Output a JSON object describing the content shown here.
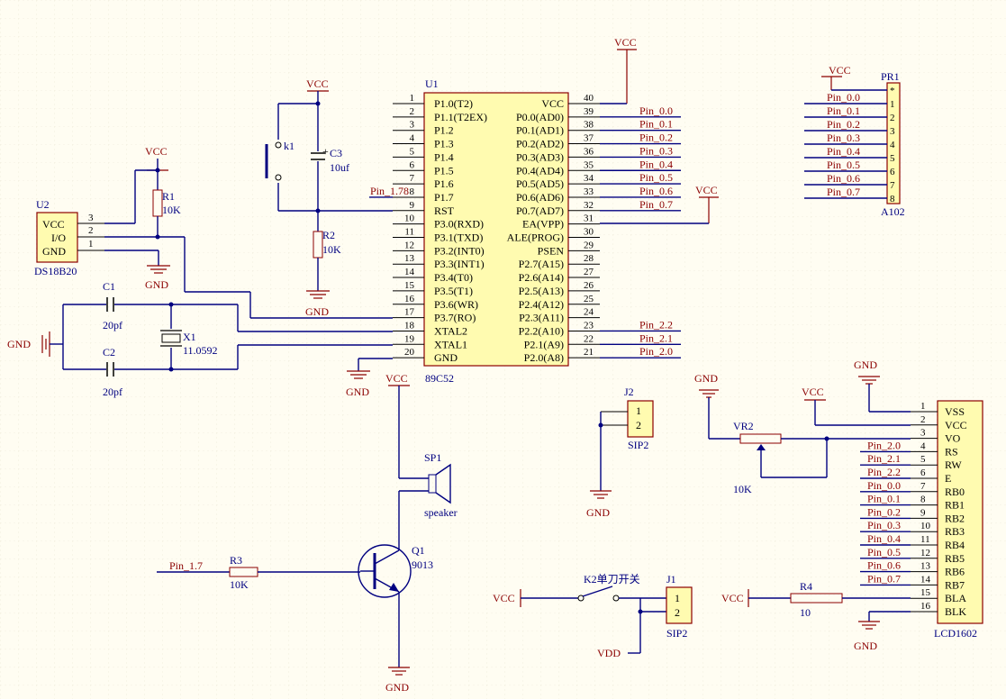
{
  "u1": {
    "ref": "U1",
    "part": "89C52",
    "left_pins": [
      {
        "num": "1",
        "name": "P1.0(T2)"
      },
      {
        "num": "2",
        "name": "P1.1(T2EX)"
      },
      {
        "num": "3",
        "name": "P1.2"
      },
      {
        "num": "4",
        "name": "P1.3"
      },
      {
        "num": "5",
        "name": "P1.4"
      },
      {
        "num": "6",
        "name": "P1.5"
      },
      {
        "num": "7",
        "name": "P1.6"
      },
      {
        "num": "8",
        "name": "P1.7"
      },
      {
        "num": "9",
        "name": "RST"
      },
      {
        "num": "10",
        "name": "P3.0(RXD)"
      },
      {
        "num": "11",
        "name": "P3.1(TXD)"
      },
      {
        "num": "12",
        "name": "P3.2(INT0)"
      },
      {
        "num": "13",
        "name": "P3.3(INT1)"
      },
      {
        "num": "14",
        "name": "P3.4(T0)"
      },
      {
        "num": "15",
        "name": "P3.5(T1)"
      },
      {
        "num": "16",
        "name": "P3.6(WR)"
      },
      {
        "num": "17",
        "name": "P3.7(RO)"
      },
      {
        "num": "18",
        "name": "XTAL2"
      },
      {
        "num": "19",
        "name": "XTAL1"
      },
      {
        "num": "20",
        "name": "GND"
      }
    ],
    "right_pins": [
      {
        "num": "40",
        "name": "VCC"
      },
      {
        "num": "39",
        "name": "P0.0(AD0)"
      },
      {
        "num": "38",
        "name": "P0.1(AD1)"
      },
      {
        "num": "37",
        "name": "P0.2(AD2)"
      },
      {
        "num": "36",
        "name": "P0.3(AD3)"
      },
      {
        "num": "35",
        "name": "P0.4(AD4)"
      },
      {
        "num": "34",
        "name": "P0.5(AD5)"
      },
      {
        "num": "33",
        "name": "P0.6(AD6)"
      },
      {
        "num": "32",
        "name": "P0.7(AD7)"
      },
      {
        "num": "31",
        "name": "EA(VPP)"
      },
      {
        "num": "30",
        "name": "ALE(PROG)"
      },
      {
        "num": "29",
        "name": "PSEN"
      },
      {
        "num": "28",
        "name": "P2.7(A15)"
      },
      {
        "num": "27",
        "name": "P2.6(A14)"
      },
      {
        "num": "26",
        "name": "P2.5(A13)"
      },
      {
        "num": "25",
        "name": "P2.4(A12)"
      },
      {
        "num": "24",
        "name": "P2.3(A11)"
      },
      {
        "num": "23",
        "name": "P2.2(A10)"
      },
      {
        "num": "22",
        "name": "P2.1(A9)"
      },
      {
        "num": "21",
        "name": "P2.0(A8)"
      }
    ],
    "right_nets": [
      "",
      "Pin_0.0",
      "Pin_0.1",
      "Pin_0.2",
      "Pin_0.3",
      "Pin_0.4",
      "Pin_0.5",
      "Pin_0.6",
      "Pin_0.7",
      "",
      "",
      "",
      "",
      "",
      "",
      "",
      "",
      "Pin_2.2",
      "Pin_2.1",
      "Pin_2.0"
    ],
    "left_net_p17": "Pin_1.78"
  },
  "pr1": {
    "ref": "PR1",
    "part": "A102",
    "pins": [
      "*",
      "1",
      "2",
      "3",
      "4",
      "5",
      "6",
      "7",
      "8"
    ],
    "nets": [
      "Pin_0.0",
      "Pin_0.1",
      "Pin_0.2",
      "Pin_0.3",
      "Pin_0.4",
      "Pin_0.5",
      "Pin_0.6",
      "Pin_0.7"
    ]
  },
  "lcd": {
    "ref": "LCD1602",
    "pins": [
      {
        "num": "1",
        "name": "VSS",
        "net": ""
      },
      {
        "num": "2",
        "name": "VCC",
        "net": ""
      },
      {
        "num": "3",
        "name": "VO",
        "net": ""
      },
      {
        "num": "4",
        "name": "RS",
        "net": "Pin_2.0"
      },
      {
        "num": "5",
        "name": "RW",
        "net": "Pin_2.1"
      },
      {
        "num": "6",
        "name": "E",
        "net": "Pin_2.2"
      },
      {
        "num": "7",
        "name": "RB0",
        "net": "Pin_0.0"
      },
      {
        "num": "8",
        "name": "RB1",
        "net": "Pin_0.1"
      },
      {
        "num": "9",
        "name": "RB2",
        "net": "Pin_0.2"
      },
      {
        "num": "10",
        "name": "RB3",
        "net": "Pin_0.3"
      },
      {
        "num": "11",
        "name": "RB4",
        "net": "Pin_0.4"
      },
      {
        "num": "12",
        "name": "RB5",
        "net": "Pin_0.5"
      },
      {
        "num": "13",
        "name": "RB6",
        "net": "Pin_0.6"
      },
      {
        "num": "14",
        "name": "RB7",
        "net": "Pin_0.7"
      },
      {
        "num": "15",
        "name": "BLA",
        "net": ""
      },
      {
        "num": "16",
        "name": "BLK",
        "net": ""
      }
    ]
  },
  "u2": {
    "ref": "U2",
    "part": "DS18B20",
    "pins": [
      "VCC",
      "I/O",
      "GND"
    ],
    "nums": [
      "3",
      "2",
      "1"
    ]
  },
  "labels": {
    "vcc": "VCC",
    "gnd": "GND",
    "vdd": "VDD",
    "r1": "R1",
    "r1v": "10K",
    "r2": "R2",
    "r2v": "10K",
    "r3": "R3",
    "r3v": "10K",
    "r4": "R4",
    "r4v": "10",
    "c1": "C1",
    "c1v": "20pf",
    "c2": "C2",
    "c2v": "20pf",
    "c3": "C3",
    "c3v": "10uf",
    "c3plus": "+",
    "x1": "X1",
    "x1v": "11.0592",
    "k1": "k1",
    "vr2": "VR2",
    "vr2v": "10K",
    "sp1": "SP1",
    "sp1v": "speaker",
    "q1": "Q1",
    "q1v": "9013",
    "pin17": "Pin_1.7",
    "j1": "J1",
    "j1v": "SIP2",
    "j2": "J2",
    "j2v": "SIP2",
    "one": "1",
    "two": "2",
    "k2": "K2单刀开关"
  }
}
